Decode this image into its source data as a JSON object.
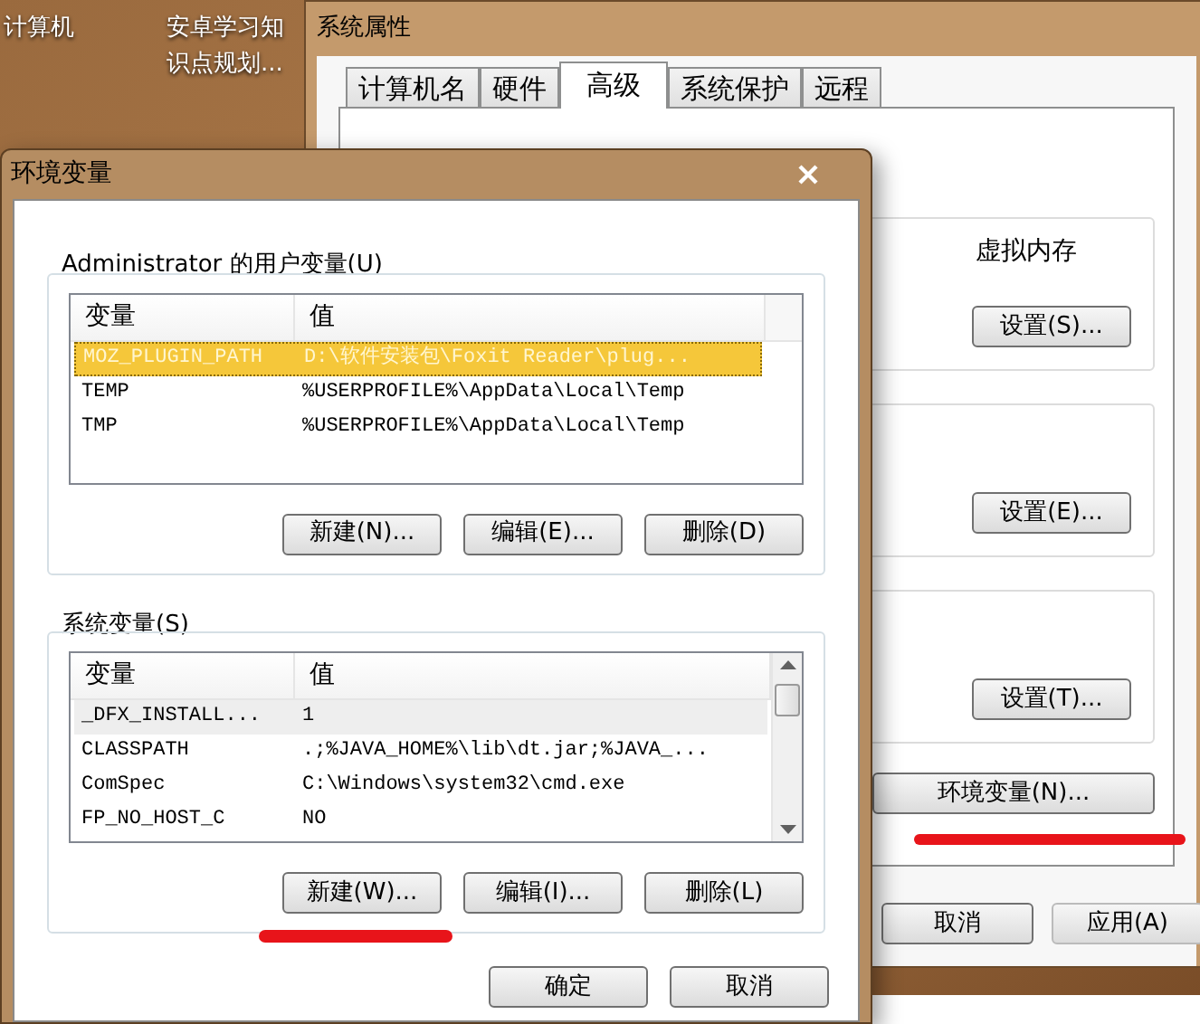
{
  "desktop_icons": [
    {
      "label": "计算机"
    },
    {
      "label": "安卓学习知识点规划..."
    }
  ],
  "system_properties": {
    "title": "系统属性",
    "tabs": [
      {
        "label": "计算机名",
        "selected": false
      },
      {
        "label": "硬件",
        "selected": false
      },
      {
        "label": "高级",
        "selected": true
      },
      {
        "label": "系统保护",
        "selected": false
      },
      {
        "label": "远程",
        "selected": false
      }
    ],
    "groups": [
      {
        "label": "虚拟内存",
        "button": "设置(S)..."
      },
      {
        "button": "设置(E)..."
      },
      {
        "button": "设置(T)..."
      }
    ],
    "env_button": "环境变量(N)...",
    "buttons": [
      {
        "label": "取消",
        "disabled": false
      },
      {
        "label": "应用(A)",
        "disabled": true
      }
    ]
  },
  "env_dialog": {
    "title": "环境变量",
    "lists": [
      {
        "label": "Administrator 的用户变量(U)",
        "focused": true,
        "scrollbar": false,
        "columns": [
          "变量",
          "值"
        ],
        "rows": [
          {
            "name": "MOZ_PLUGIN_PATH",
            "value": "D:\\软件安装包\\Foxit Reader\\plug...",
            "selected": true
          },
          {
            "name": "TEMP",
            "value": "%USERPROFILE%\\AppData\\Local\\Temp",
            "selected": false
          },
          {
            "name": "TMP",
            "value": "%USERPROFILE%\\AppData\\Local\\Temp",
            "selected": false
          }
        ],
        "buttons": [
          "新建(N)...",
          "编辑(E)...",
          "删除(D)"
        ]
      },
      {
        "label": "系统变量(S)",
        "focused": false,
        "scrollbar": true,
        "columns": [
          "变量",
          "值"
        ],
        "rows": [
          {
            "name": "_DFX_INSTALL...",
            "value": "1",
            "selected": true
          },
          {
            "name": "CLASSPATH",
            "value": ".;%JAVA_HOME%\\lib\\dt.jar;%JAVA_...",
            "selected": false
          },
          {
            "name": "ComSpec",
            "value": "C:\\Windows\\system32\\cmd.exe",
            "selected": false
          },
          {
            "name": "FP_NO_HOST_C",
            "value": "NO",
            "selected": false
          }
        ],
        "buttons": [
          "新建(W)...",
          "编辑(I)...",
          "删除(L)"
        ]
      }
    ],
    "buttons": [
      "确定",
      "取消"
    ]
  }
}
